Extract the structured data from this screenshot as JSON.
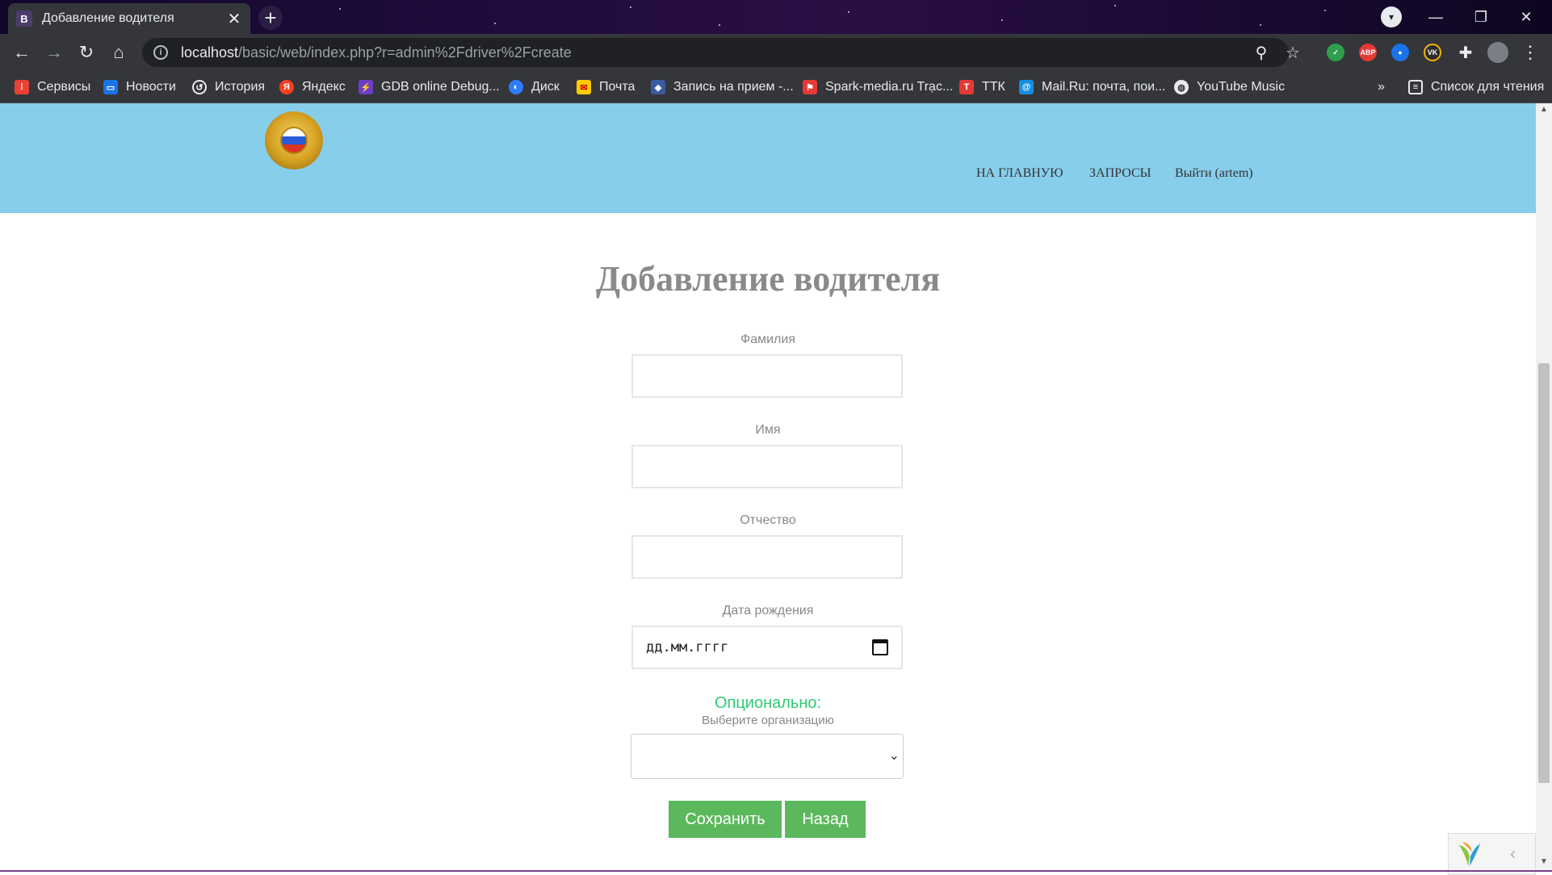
{
  "browser": {
    "tab_favicon": "В",
    "tab_title": "Добавление водителя",
    "tab_close": "✕",
    "new_tab": "+",
    "url_host": "localhost",
    "url_path": "/basic/web/index.php?r=admin%2Fdriver%2Fcreate",
    "bookmarks": [
      {
        "label": "Сервисы",
        "icon": "apps-grid-icon",
        "color": "#e94235"
      },
      {
        "label": "Новости",
        "icon": "news-icon",
        "color": "#1a73e8"
      },
      {
        "label": "История",
        "icon": "history-icon",
        "color": "#5f6368"
      },
      {
        "label": "Яндекс",
        "icon": "yandex-icon",
        "color": "#fc3f1d"
      },
      {
        "label": "GDB online Debug...",
        "icon": "gdb-icon",
        "color": "#6a3fc7"
      },
      {
        "label": "Диск",
        "icon": "disk-icon",
        "color": "#2f7cf6"
      },
      {
        "label": "Почта",
        "icon": "mail-icon",
        "color": "#ffcc00"
      },
      {
        "label": "Запись на прием -...",
        "icon": "emblem-icon",
        "color": "#3a5ba0"
      },
      {
        "label": "Spark-media.ru Trạc...",
        "icon": "spark-icon",
        "color": "#e53935"
      },
      {
        "label": "ТТК",
        "icon": "ttk-icon",
        "color": "#e53935"
      },
      {
        "label": "Mail.Ru: почта, пои...",
        "icon": "mailru-icon",
        "color": "#168de2"
      },
      {
        "label": "YouTube Music",
        "icon": "globe-icon",
        "color": "#9aa0a6"
      }
    ],
    "bookmarks_more": "»",
    "reading_list": "Список для чтения"
  },
  "header": {
    "nav": [
      {
        "label": "НА ГЛАВНУЮ"
      },
      {
        "label": "ЗАПРОСЫ"
      },
      {
        "label": "Выйти (artem)"
      }
    ]
  },
  "form": {
    "title": "Добавление водителя",
    "surname_label": "Фамилия",
    "surname_value": "",
    "name_label": "Имя",
    "name_value": "",
    "patronymic_label": "Отчество",
    "patronymic_value": "",
    "birthdate_label": "Дата рождения",
    "birthdate_placeholder": "дд.мм.гггг",
    "optional_label": "Опционально:",
    "org_label": "Выберите организацию",
    "org_selected": "",
    "save_button": "Сохранить",
    "back_button": "Назад"
  },
  "colors": {
    "header_bg": "#87ceeb",
    "button_green": "#5cb85c",
    "optional_green": "#2ecc71"
  }
}
